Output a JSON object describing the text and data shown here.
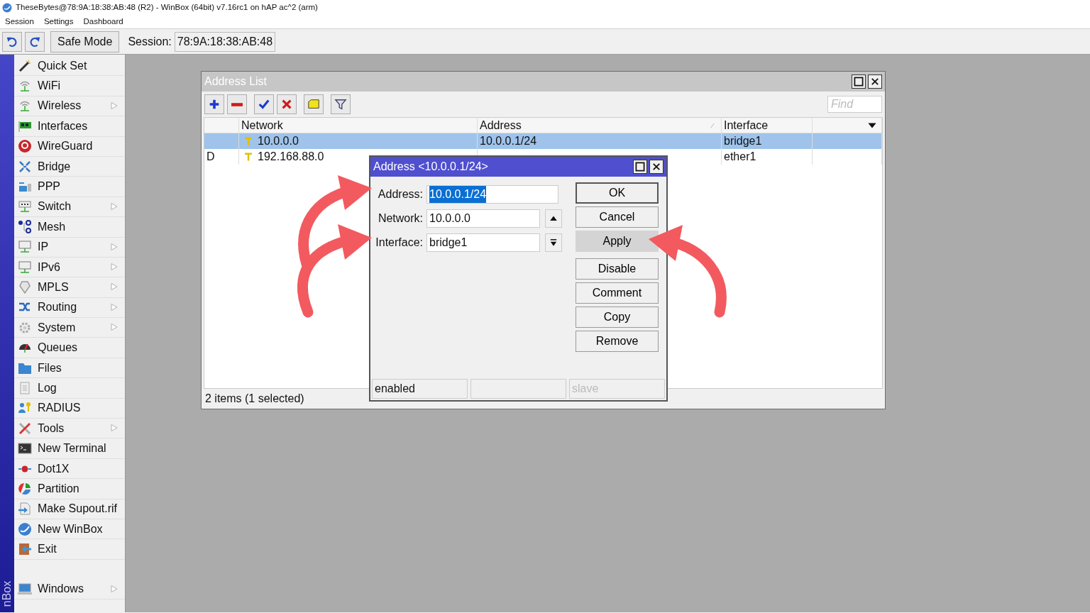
{
  "window": {
    "title": "TheseBytes@78:9A:18:38:AB:48 (R2) - WinBox (64bit) v7.16rc1 on hAP ac^2 (arm)"
  },
  "menu": [
    "Session",
    "Settings",
    "Dashboard"
  ],
  "toolbar": {
    "safe_mode": "Safe Mode",
    "session_label": "Session:",
    "session_value": "78:9A:18:38:AB:48"
  },
  "sidebar": {
    "brand": "nBox",
    "items": [
      {
        "label": "Quick Set",
        "submenu": false
      },
      {
        "label": "WiFi",
        "submenu": false
      },
      {
        "label": "Wireless",
        "submenu": true
      },
      {
        "label": "Interfaces",
        "submenu": false
      },
      {
        "label": "WireGuard",
        "submenu": false
      },
      {
        "label": "Bridge",
        "submenu": false
      },
      {
        "label": "PPP",
        "submenu": false
      },
      {
        "label": "Switch",
        "submenu": true
      },
      {
        "label": "Mesh",
        "submenu": false
      },
      {
        "label": "IP",
        "submenu": true
      },
      {
        "label": "IPv6",
        "submenu": true
      },
      {
        "label": "MPLS",
        "submenu": true
      },
      {
        "label": "Routing",
        "submenu": true
      },
      {
        "label": "System",
        "submenu": true
      },
      {
        "label": "Queues",
        "submenu": false
      },
      {
        "label": "Files",
        "submenu": false
      },
      {
        "label": "Log",
        "submenu": false
      },
      {
        "label": "RADIUS",
        "submenu": false
      },
      {
        "label": "Tools",
        "submenu": true
      },
      {
        "label": "New Terminal",
        "submenu": false
      },
      {
        "label": "Dot1X",
        "submenu": false
      },
      {
        "label": "Partition",
        "submenu": false
      },
      {
        "label": "Make Supout.rif",
        "submenu": false
      },
      {
        "label": "New WinBox",
        "submenu": false
      },
      {
        "label": "Exit",
        "submenu": false
      }
    ],
    "bottom_items": [
      {
        "label": "Windows",
        "submenu": true
      }
    ]
  },
  "address_list": {
    "title": "Address List",
    "find": {
      "placeholder": "Find"
    },
    "columns": [
      {
        "label": "Network",
        "sorted": false
      },
      {
        "label": "Address",
        "sorted": true
      },
      {
        "label": "Interface",
        "sorted": false
      }
    ],
    "rows": [
      {
        "network": "10.0.0.0",
        "address": "10.0.0.1/24",
        "interface": "bridge1",
        "selected": true
      },
      {
        "flag": "D",
        "network": "192.168.88.0",
        "interface": "ether1",
        "selected": false
      }
    ],
    "status": "2 items (1 selected)"
  },
  "dialog": {
    "title": "Address <10.0.0.1/24>",
    "fields": [
      {
        "label": "Address:",
        "value": "10.0.0.1/24",
        "kind": "text",
        "text_selected": true
      },
      {
        "label": "Network:",
        "value": "10.0.0.0",
        "kind": "spin",
        "text_selected": false
      },
      {
        "label": "Interface:",
        "value": "bridge1",
        "kind": "dropdown",
        "text_selected": false
      }
    ],
    "buttons": [
      {
        "label": "OK",
        "default": true,
        "highlighted": false
      },
      {
        "label": "Cancel",
        "default": false,
        "highlighted": false
      },
      {
        "label": "Apply",
        "default": false,
        "highlighted": true
      }
    ],
    "action_buttons": [
      "Disable",
      "Comment",
      "Copy",
      "Remove"
    ],
    "status_left": {
      "text": "enabled",
      "disabled": false
    },
    "status_right": {
      "text": "slave",
      "disabled": true
    }
  }
}
